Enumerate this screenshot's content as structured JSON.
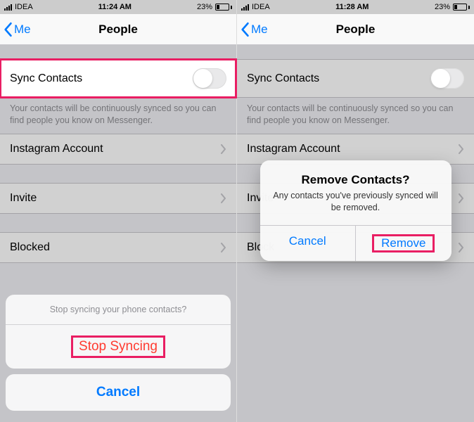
{
  "colors": {
    "accent": "#007aff",
    "destructive": "#ff3b30",
    "highlight": "#e91e63"
  },
  "status": {
    "carrier": "IDEA",
    "battery": "23%"
  },
  "nav": {
    "back": "Me",
    "title": "People"
  },
  "rows": {
    "sync": "Sync Contacts",
    "sync_help": "Your contacts will be continuously synced so you can find people you know on Messenger.",
    "instagram": "Instagram Account",
    "invite": "Invite",
    "blocked": "Blocked"
  },
  "sheet": {
    "title": "Stop syncing your phone contacts?",
    "stop": "Stop Syncing",
    "cancel": "Cancel"
  },
  "alert": {
    "title": "Remove Contacts?",
    "msg": "Any contacts you've previously synced will be removed.",
    "cancel": "Cancel",
    "remove": "Remove"
  },
  "left": {
    "time": "11:24 AM"
  },
  "right": {
    "time": "11:28 AM",
    "invite_truncated": "Invite",
    "blocked_truncated": "Block"
  }
}
